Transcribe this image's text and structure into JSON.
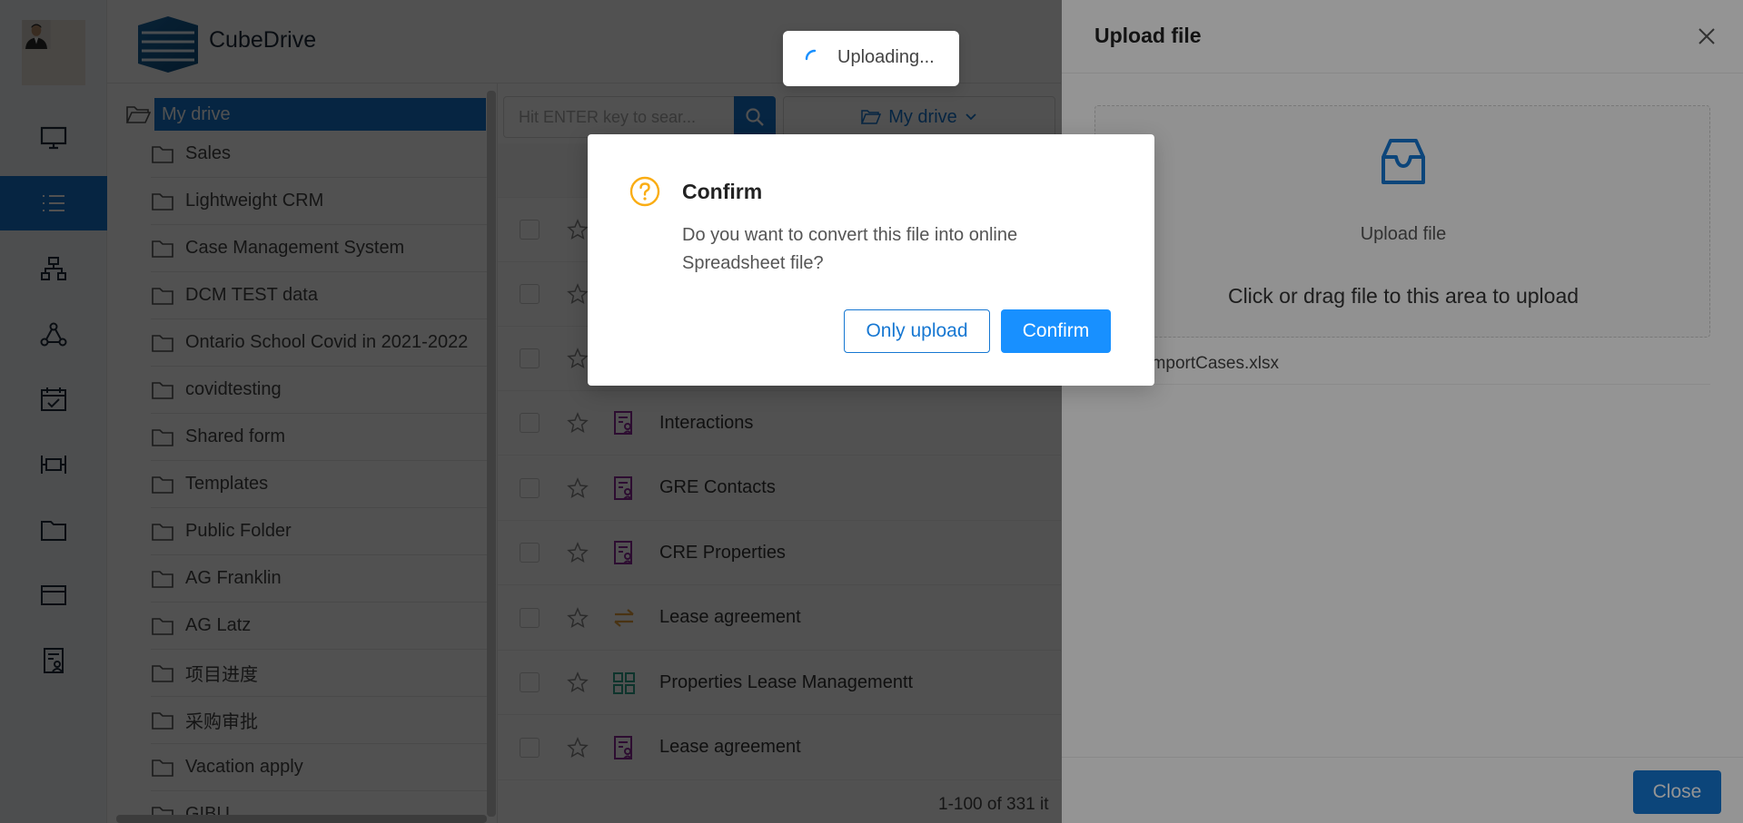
{
  "app": {
    "brand": "CubeDrive"
  },
  "tree": {
    "root_label": "My drive",
    "items": [
      "Sales",
      "Lightweight CRM",
      "Case Management System",
      "DCM TEST data",
      "Ontario School Covid in 2021-2022",
      "covidtesting",
      "Shared form",
      "Templates",
      "Public Folder",
      "AG Franklin",
      "AG Latz",
      "项目进度",
      "采购审批",
      "Vacation apply",
      "GIBU"
    ]
  },
  "list": {
    "search_placeholder": "Hit ENTER key to sear...",
    "drive_select": "My drive",
    "rows": [
      {
        "name": "Interactions",
        "icon": "form-icon"
      },
      {
        "name": "GRE Contacts",
        "icon": "form-icon"
      },
      {
        "name": "CRE Properties",
        "icon": "form-icon"
      },
      {
        "name": "Lease agreement",
        "icon": "transfer-icon"
      },
      {
        "name": "Properties Lease Managementt",
        "icon": "grid-app-icon"
      },
      {
        "name": "Lease agreement",
        "icon": "form-icon"
      }
    ],
    "count": "1-100 of 331 it"
  },
  "drawer": {
    "title": "Upload file",
    "dz_title": "Upload file",
    "dz_hint": "Click or drag file to this area to upload",
    "file_name": "tImportCases.xlsx",
    "close_label": "Close"
  },
  "toast": {
    "text": "Uploading..."
  },
  "modal": {
    "title": "Confirm",
    "body": "Do you want to convert this file into online Spreadsheet file?",
    "only_upload": "Only upload",
    "confirm": "Confirm"
  },
  "colors": {
    "primary": "#1677d2",
    "confirm": "#1890ff",
    "warning": "#faad14",
    "form_icon": "#8e2b9c",
    "grid_icon": "#2fa58a",
    "transfer_icon": "#e8a23c"
  }
}
